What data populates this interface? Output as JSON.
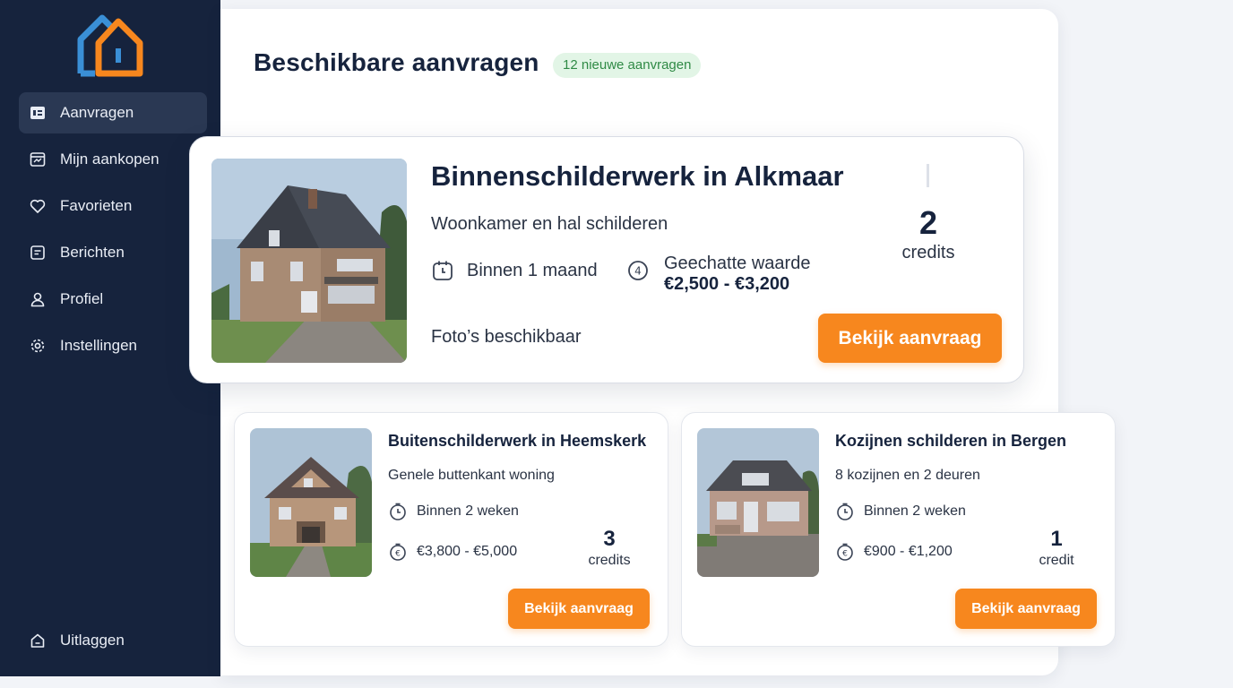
{
  "colors": {
    "sidebar": "#16233d",
    "accent": "#f7871e",
    "badge_bg": "#e2f5e6",
    "badge_text": "#2f8a45",
    "logo_blue": "#3a8fd6",
    "logo_orange": "#f7871e"
  },
  "sidebar": {
    "logo_icon": "house-logo-icon",
    "items": [
      {
        "label": "Aanvragen",
        "icon": "requests-icon",
        "active": true
      },
      {
        "label": "Mijn aankopen",
        "icon": "purchases-icon",
        "active": false
      },
      {
        "label": "Favorieten",
        "icon": "heart-icon",
        "active": false
      },
      {
        "label": "Berichten",
        "icon": "message-icon",
        "active": false
      },
      {
        "label": "Profiel",
        "icon": "user-icon",
        "active": false
      },
      {
        "label": "Instellingen",
        "icon": "gear-icon",
        "active": false
      }
    ],
    "logout": {
      "label": "Uitlaggen",
      "icon": "logout-icon"
    }
  },
  "header": {
    "title": "Beschikbare aanvragen",
    "badge": "12 nieuwe aanvragen"
  },
  "featured": {
    "title": "Binnenschilderwerk in Alkmaar",
    "subtitle": "Woonkamer en hal schilderen",
    "timeframe": "Binnen 1 maand",
    "value_label": "Geechatte waarde",
    "value_amount": "€2,500 - €3,200",
    "photos_note": "Foto’s beschikbaar",
    "credits_num": "2",
    "credits_label": "credits",
    "button": "Bekijk aanvraag"
  },
  "cards": [
    {
      "title": "Buitenschilderwerk in Heemskerk",
      "subtitle": "Genele buttenkant woning",
      "timeframe": "Binnen 2 weken",
      "price": "€3,800 - €5,000",
      "credits_num": "3",
      "credits_label": "credits",
      "button": "Bekijk aanvraag"
    },
    {
      "title": "Kozijnen schilderen in Bergen",
      "subtitle": "8 kozijnen en 2 deuren",
      "timeframe": "Binnen 2 weken",
      "price": "€900 - €1,200",
      "credits_num": "1",
      "credits_label": "credit",
      "button": "Bekijk aanvraag"
    }
  ]
}
